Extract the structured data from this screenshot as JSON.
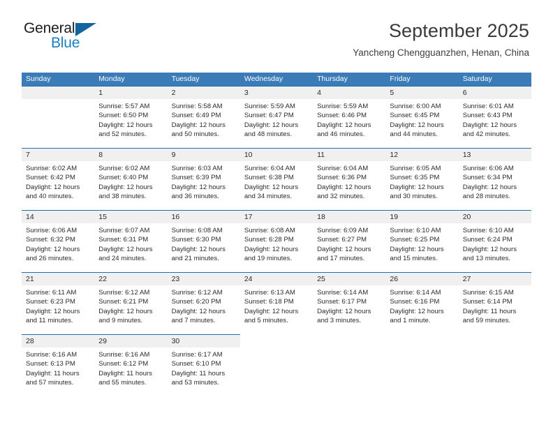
{
  "brand": {
    "line1": "General",
    "line2": "Blue",
    "triangle_icon": "triangle-icon",
    "color_dark": "#1b1b1b",
    "color_blue": "#1a7fc1"
  },
  "header": {
    "title": "September 2025",
    "subtitle": "Yancheng Chengguanzhen, Henan, China"
  },
  "theme": {
    "header_row_bg": "#3b7cb8",
    "row_border": "#1f6cb0",
    "day_band_bg": "#f0f0f0",
    "text": "#2b2b2b"
  },
  "weekdays": [
    "Sunday",
    "Monday",
    "Tuesday",
    "Wednesday",
    "Thursday",
    "Friday",
    "Saturday"
  ],
  "labels": {
    "sunrise": "Sunrise:",
    "sunset": "Sunset:",
    "daylight": "Daylight:"
  },
  "weeks": [
    [
      {
        "day": "",
        "blank": true
      },
      {
        "day": "1",
        "sunrise": "Sunrise: 5:57 AM",
        "sunset": "Sunset: 6:50 PM",
        "daylight": "Daylight: 12 hours and 52 minutes."
      },
      {
        "day": "2",
        "sunrise": "Sunrise: 5:58 AM",
        "sunset": "Sunset: 6:49 PM",
        "daylight": "Daylight: 12 hours and 50 minutes."
      },
      {
        "day": "3",
        "sunrise": "Sunrise: 5:59 AM",
        "sunset": "Sunset: 6:47 PM",
        "daylight": "Daylight: 12 hours and 48 minutes."
      },
      {
        "day": "4",
        "sunrise": "Sunrise: 5:59 AM",
        "sunset": "Sunset: 6:46 PM",
        "daylight": "Daylight: 12 hours and 46 minutes."
      },
      {
        "day": "5",
        "sunrise": "Sunrise: 6:00 AM",
        "sunset": "Sunset: 6:45 PM",
        "daylight": "Daylight: 12 hours and 44 minutes."
      },
      {
        "day": "6",
        "sunrise": "Sunrise: 6:01 AM",
        "sunset": "Sunset: 6:43 PM",
        "daylight": "Daylight: 12 hours and 42 minutes."
      }
    ],
    [
      {
        "day": "7",
        "sunrise": "Sunrise: 6:02 AM",
        "sunset": "Sunset: 6:42 PM",
        "daylight": "Daylight: 12 hours and 40 minutes."
      },
      {
        "day": "8",
        "sunrise": "Sunrise: 6:02 AM",
        "sunset": "Sunset: 6:40 PM",
        "daylight": "Daylight: 12 hours and 38 minutes."
      },
      {
        "day": "9",
        "sunrise": "Sunrise: 6:03 AM",
        "sunset": "Sunset: 6:39 PM",
        "daylight": "Daylight: 12 hours and 36 minutes."
      },
      {
        "day": "10",
        "sunrise": "Sunrise: 6:04 AM",
        "sunset": "Sunset: 6:38 PM",
        "daylight": "Daylight: 12 hours and 34 minutes."
      },
      {
        "day": "11",
        "sunrise": "Sunrise: 6:04 AM",
        "sunset": "Sunset: 6:36 PM",
        "daylight": "Daylight: 12 hours and 32 minutes."
      },
      {
        "day": "12",
        "sunrise": "Sunrise: 6:05 AM",
        "sunset": "Sunset: 6:35 PM",
        "daylight": "Daylight: 12 hours and 30 minutes."
      },
      {
        "day": "13",
        "sunrise": "Sunrise: 6:06 AM",
        "sunset": "Sunset: 6:34 PM",
        "daylight": "Daylight: 12 hours and 28 minutes."
      }
    ],
    [
      {
        "day": "14",
        "sunrise": "Sunrise: 6:06 AM",
        "sunset": "Sunset: 6:32 PM",
        "daylight": "Daylight: 12 hours and 26 minutes."
      },
      {
        "day": "15",
        "sunrise": "Sunrise: 6:07 AM",
        "sunset": "Sunset: 6:31 PM",
        "daylight": "Daylight: 12 hours and 24 minutes."
      },
      {
        "day": "16",
        "sunrise": "Sunrise: 6:08 AM",
        "sunset": "Sunset: 6:30 PM",
        "daylight": "Daylight: 12 hours and 21 minutes."
      },
      {
        "day": "17",
        "sunrise": "Sunrise: 6:08 AM",
        "sunset": "Sunset: 6:28 PM",
        "daylight": "Daylight: 12 hours and 19 minutes."
      },
      {
        "day": "18",
        "sunrise": "Sunrise: 6:09 AM",
        "sunset": "Sunset: 6:27 PM",
        "daylight": "Daylight: 12 hours and 17 minutes."
      },
      {
        "day": "19",
        "sunrise": "Sunrise: 6:10 AM",
        "sunset": "Sunset: 6:25 PM",
        "daylight": "Daylight: 12 hours and 15 minutes."
      },
      {
        "day": "20",
        "sunrise": "Sunrise: 6:10 AM",
        "sunset": "Sunset: 6:24 PM",
        "daylight": "Daylight: 12 hours and 13 minutes."
      }
    ],
    [
      {
        "day": "21",
        "sunrise": "Sunrise: 6:11 AM",
        "sunset": "Sunset: 6:23 PM",
        "daylight": "Daylight: 12 hours and 11 minutes."
      },
      {
        "day": "22",
        "sunrise": "Sunrise: 6:12 AM",
        "sunset": "Sunset: 6:21 PM",
        "daylight": "Daylight: 12 hours and 9 minutes."
      },
      {
        "day": "23",
        "sunrise": "Sunrise: 6:12 AM",
        "sunset": "Sunset: 6:20 PM",
        "daylight": "Daylight: 12 hours and 7 minutes."
      },
      {
        "day": "24",
        "sunrise": "Sunrise: 6:13 AM",
        "sunset": "Sunset: 6:18 PM",
        "daylight": "Daylight: 12 hours and 5 minutes."
      },
      {
        "day": "25",
        "sunrise": "Sunrise: 6:14 AM",
        "sunset": "Sunset: 6:17 PM",
        "daylight": "Daylight: 12 hours and 3 minutes."
      },
      {
        "day": "26",
        "sunrise": "Sunrise: 6:14 AM",
        "sunset": "Sunset: 6:16 PM",
        "daylight": "Daylight: 12 hours and 1 minute."
      },
      {
        "day": "27",
        "sunrise": "Sunrise: 6:15 AM",
        "sunset": "Sunset: 6:14 PM",
        "daylight": "Daylight: 11 hours and 59 minutes."
      }
    ],
    [
      {
        "day": "28",
        "sunrise": "Sunrise: 6:16 AM",
        "sunset": "Sunset: 6:13 PM",
        "daylight": "Daylight: 11 hours and 57 minutes."
      },
      {
        "day": "29",
        "sunrise": "Sunrise: 6:16 AM",
        "sunset": "Sunset: 6:12 PM",
        "daylight": "Daylight: 11 hours and 55 minutes."
      },
      {
        "day": "30",
        "sunrise": "Sunrise: 6:17 AM",
        "sunset": "Sunset: 6:10 PM",
        "daylight": "Daylight: 11 hours and 53 minutes."
      },
      {
        "day": "",
        "trailing": true
      },
      {
        "day": "",
        "trailing": true
      },
      {
        "day": "",
        "trailing": true
      },
      {
        "day": "",
        "trailing": true
      }
    ]
  ]
}
